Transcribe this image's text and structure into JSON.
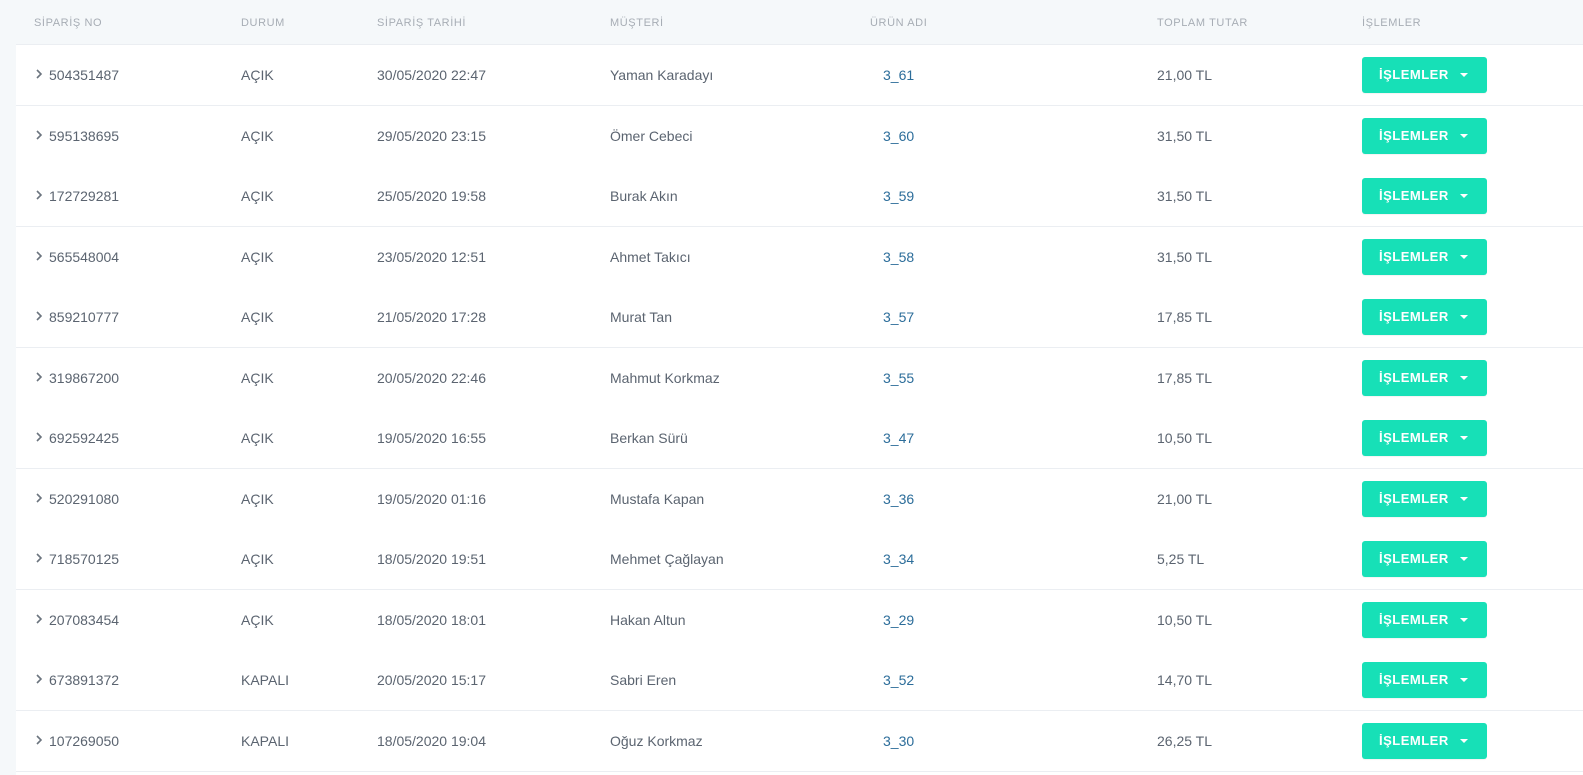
{
  "table": {
    "headers": {
      "order_no": "SİPARİŞ NO",
      "status": "DURUM",
      "date": "SİPARİŞ TARİHİ",
      "customer": "MÜŞTERİ",
      "product": "ÜRÜN ADI",
      "total": "TOPLAM TUTAR",
      "actions": "İŞLEMLER"
    },
    "action_button_label": "İŞLEMLER",
    "accent_color": "#17e0b7",
    "link_color": "#2c6d9a",
    "rows": [
      {
        "order_no": "504351487",
        "status": "AÇIK",
        "date": "30/05/2020 22:47",
        "customer": "Yaman Karadayı",
        "product": "3_61",
        "total": "21,00 TL"
      },
      {
        "order_no": "595138695",
        "status": "AÇIK",
        "date": "29/05/2020 23:15",
        "customer": "Ömer Cebeci",
        "product": "3_60",
        "total": "31,50 TL"
      },
      {
        "order_no": "172729281",
        "status": "AÇIK",
        "date": "25/05/2020 19:58",
        "customer": "Burak Akın",
        "product": "3_59",
        "total": "31,50 TL"
      },
      {
        "order_no": "565548004",
        "status": "AÇIK",
        "date": "23/05/2020 12:51",
        "customer": "Ahmet Takıcı",
        "product": "3_58",
        "total": "31,50 TL"
      },
      {
        "order_no": "859210777",
        "status": "AÇIK",
        "date": "21/05/2020 17:28",
        "customer": "Murat Tan",
        "product": "3_57",
        "total": "17,85 TL"
      },
      {
        "order_no": "319867200",
        "status": "AÇIK",
        "date": "20/05/2020 22:46",
        "customer": "Mahmut Korkmaz",
        "product": "3_55",
        "total": "17,85 TL"
      },
      {
        "order_no": "692592425",
        "status": "AÇIK",
        "date": "19/05/2020 16:55",
        "customer": "Berkan Sürü",
        "product": "3_47",
        "total": "10,50 TL"
      },
      {
        "order_no": "520291080",
        "status": "AÇIK",
        "date": "19/05/2020 01:16",
        "customer": "Mustafa Kapan",
        "product": "3_36",
        "total": "21,00 TL"
      },
      {
        "order_no": "718570125",
        "status": "AÇIK",
        "date": "18/05/2020 19:51",
        "customer": "Mehmet Çağlayan",
        "product": "3_34",
        "total": "5,25 TL"
      },
      {
        "order_no": "207083454",
        "status": "AÇIK",
        "date": "18/05/2020 18:01",
        "customer": "Hakan Altun",
        "product": "3_29",
        "total": "10,50 TL"
      },
      {
        "order_no": "673891372",
        "status": "KAPALI",
        "date": "20/05/2020 15:17",
        "customer": "Sabri Eren",
        "product": "3_52",
        "total": "14,70 TL"
      },
      {
        "order_no": "107269050",
        "status": "KAPALI",
        "date": "18/05/2020 19:04",
        "customer": "Oğuz Korkmaz",
        "product": "3_30",
        "total": "26,25 TL"
      }
    ]
  }
}
